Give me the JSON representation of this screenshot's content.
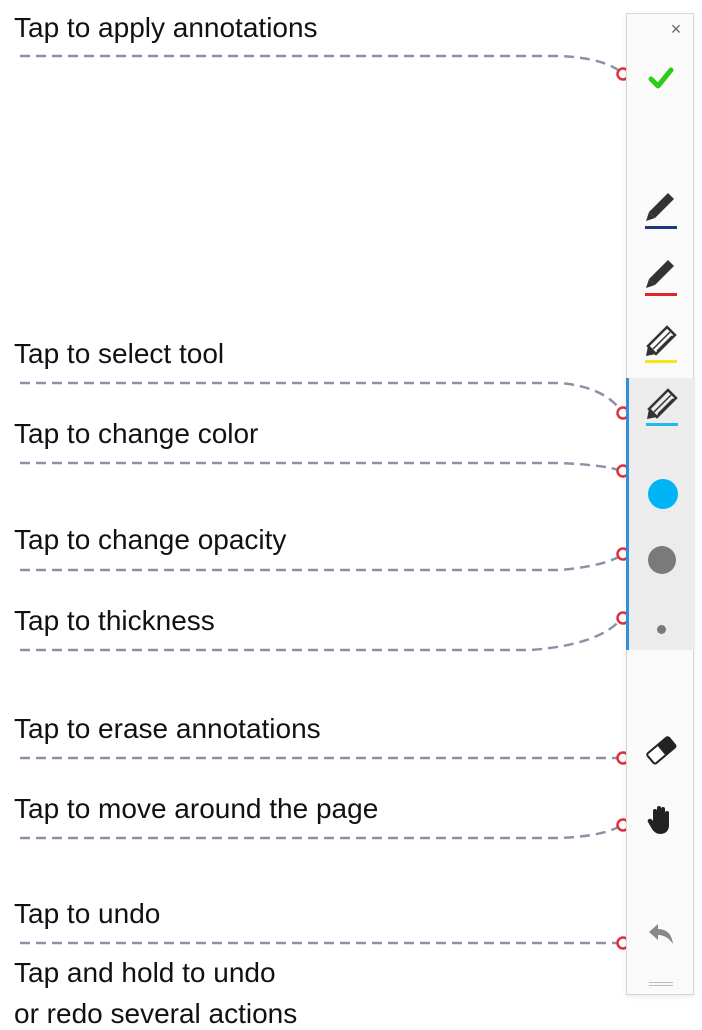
{
  "annotations": {
    "apply": "Tap to apply annotations",
    "select_tool": "Tap to select tool",
    "change_color": "Tap to change color",
    "change_opacity": "Tap to change opacity",
    "thickness": "Tap to thickness",
    "erase": "Tap to erase annotations",
    "move": "Tap to move around the page",
    "undo": "Tap to undo",
    "undo_hold_line1": "Tap and hold to undo",
    "undo_hold_line2": "or redo several actions"
  },
  "toolbar": {
    "close_glyph": "×",
    "apply_icon": "checkmark-icon",
    "pens": [
      {
        "icon": "pen-icon",
        "underline_color": "#1f3a7a"
      },
      {
        "icon": "pen-icon",
        "underline_color": "#e02626"
      },
      {
        "icon": "highlighter-icon",
        "underline_color": "#f5e61a"
      },
      {
        "icon": "highlighter-icon",
        "underline_color": "#22b8f0",
        "selected": true
      }
    ],
    "color": "#00b4f5",
    "opacity_color": "#7a7a7a",
    "thickness_color": "#7a7a7a",
    "eraser_icon": "eraser-icon",
    "hand_icon": "hand-icon",
    "undo_icon": "undo-icon",
    "accent": "#2f8fd8",
    "apply_color": "#2ecc1a"
  }
}
